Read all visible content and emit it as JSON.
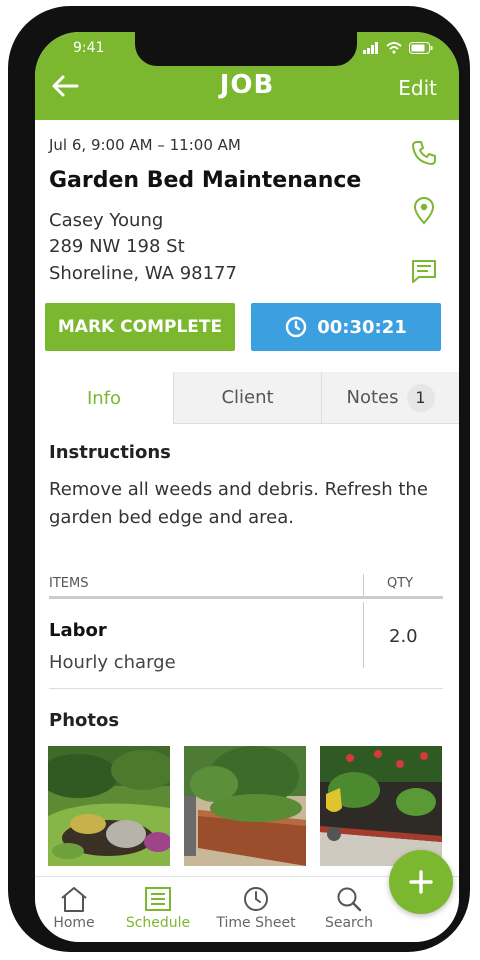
{
  "status_bar": {
    "time": "9:41"
  },
  "header": {
    "title": "JOB",
    "edit_label": "Edit"
  },
  "job": {
    "datetime": "Jul 6, 9:00 AM – 11:00 AM",
    "name": "Garden Bed Maintenance",
    "client_name": "Casey Young",
    "address_line1": "289 NW 198 St",
    "address_line2": "Shoreline, WA 98177"
  },
  "actions": {
    "complete_label": "MARK COMPLETE",
    "timer_value": "00:30:21"
  },
  "tabs": [
    {
      "label": "Info",
      "active": true
    },
    {
      "label": "Client",
      "active": false
    },
    {
      "label": "Notes",
      "active": false,
      "badge": "1"
    }
  ],
  "info": {
    "instructions_title": "Instructions",
    "instructions_text": "Remove all weeds and debris. Refresh the garden bed edge and area.",
    "items_header": "ITEMS",
    "qty_header": "QTY",
    "items": [
      {
        "name": "Labor",
        "description": "Hourly charge",
        "qty": "2.0"
      }
    ],
    "photos_title": "Photos"
  },
  "bottom_nav": [
    {
      "label": "Home",
      "icon": "home-icon",
      "active": false
    },
    {
      "label": "Schedule",
      "icon": "schedule-icon",
      "active": true
    },
    {
      "label": "Time Sheet",
      "icon": "clock-icon",
      "active": false
    },
    {
      "label": "Search",
      "icon": "search-icon",
      "active": false
    }
  ],
  "colors": {
    "brand_green": "#7cb82f",
    "timer_blue": "#3ca0e0"
  }
}
